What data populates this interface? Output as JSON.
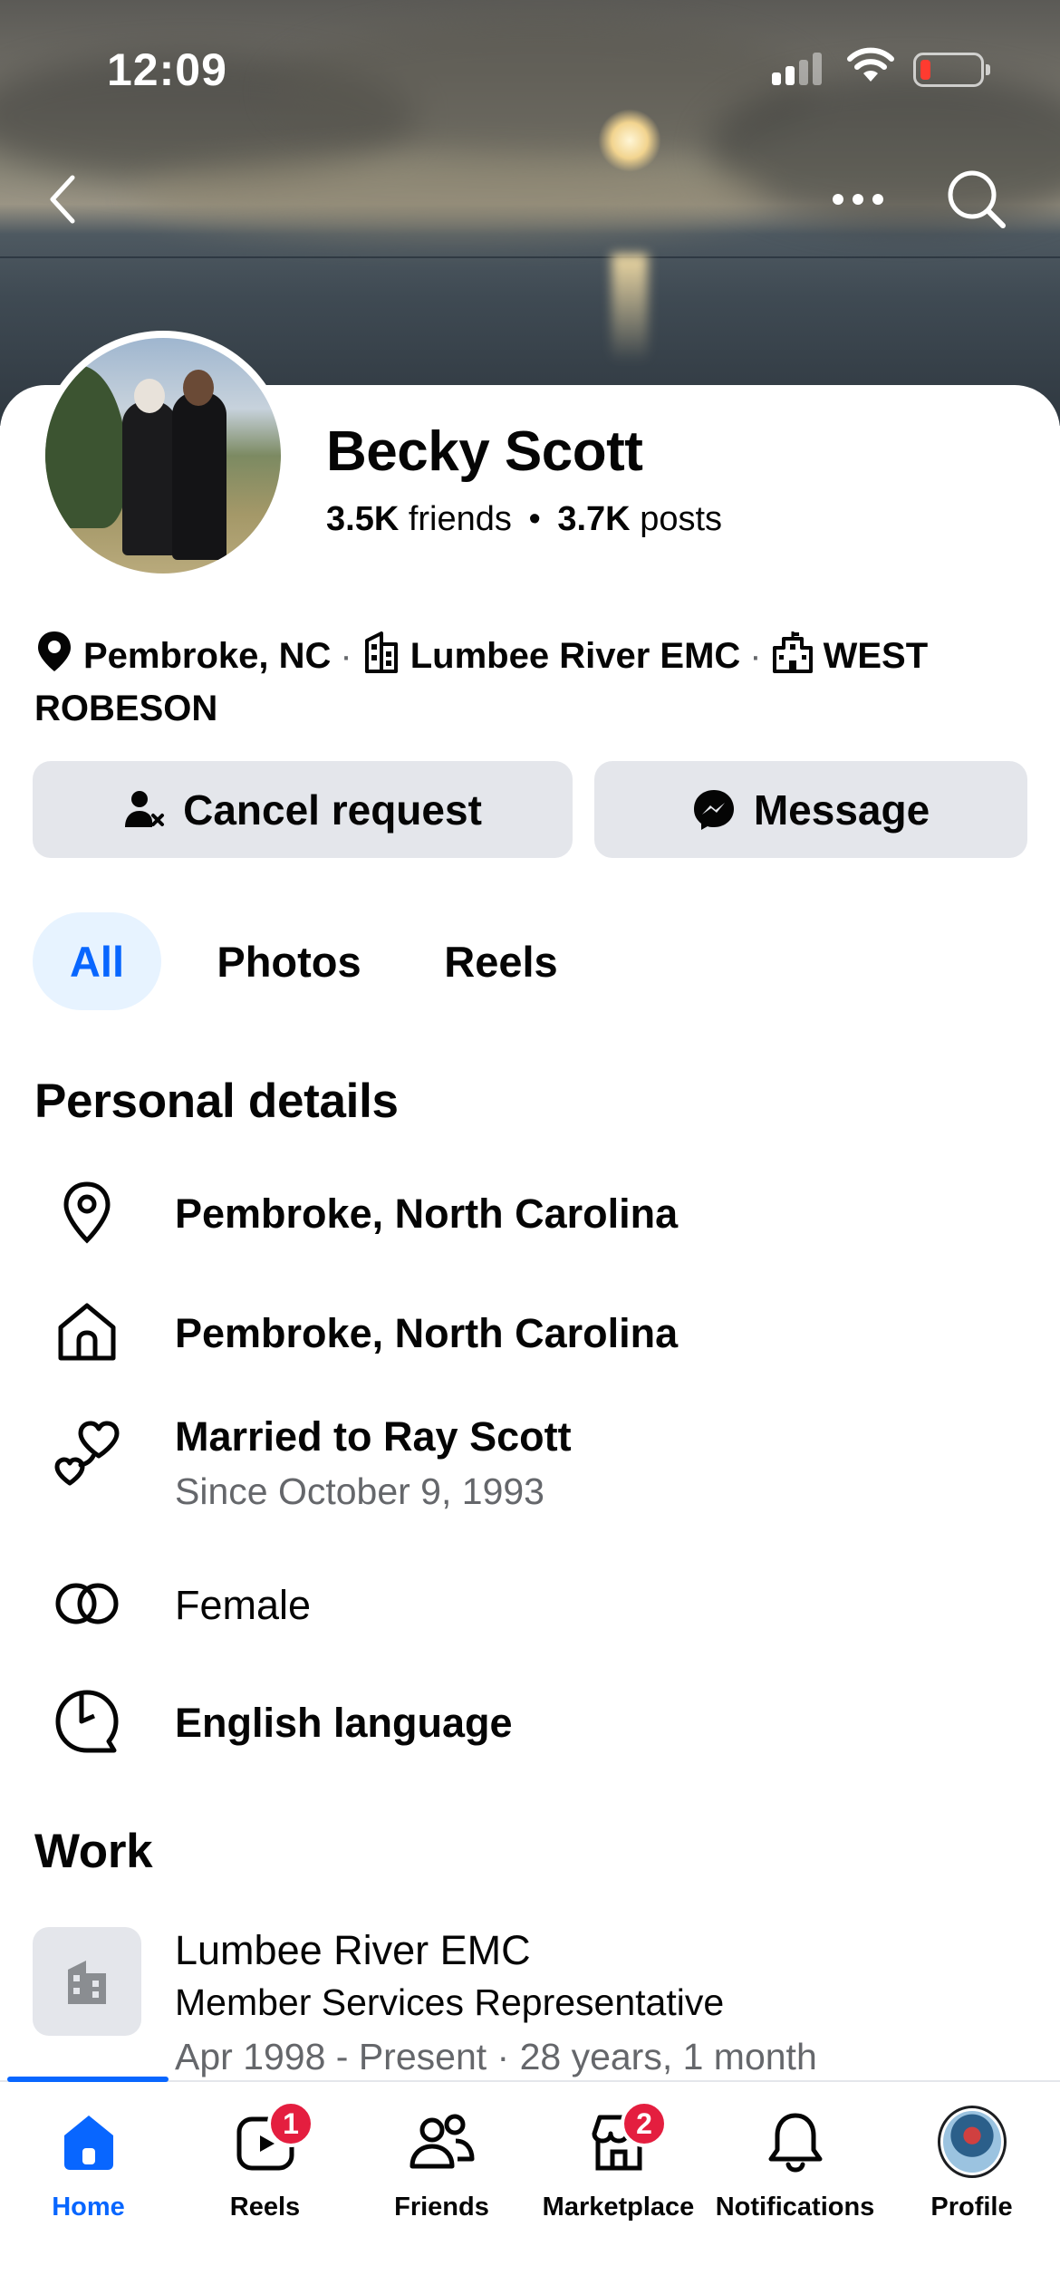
{
  "status_bar": {
    "time": "12:09"
  },
  "profile": {
    "name": "Becky Scott",
    "friends_count": "3.5K",
    "friends_label": "friends",
    "posts_count": "3.7K",
    "posts_label": "posts"
  },
  "intro": {
    "location": "Pembroke, NC",
    "workplace": "Lumbee River EMC",
    "school": "WEST ROBESON"
  },
  "actions": {
    "cancel_request_label": "Cancel request",
    "message_label": "Message"
  },
  "tabs": [
    {
      "label": "All",
      "active": true
    },
    {
      "label": "Photos",
      "active": false
    },
    {
      "label": "Reels",
      "active": false
    }
  ],
  "personal_details": {
    "title": "Personal details",
    "current_city": "Pembroke, North Carolina",
    "hometown": "Pembroke, North Carolina",
    "relationship": "Married to Ray Scott",
    "relationship_since": "Since October 9, 1993",
    "gender": "Female",
    "language": "English language"
  },
  "work": {
    "title": "Work",
    "employer": "Lumbee River EMC",
    "position": "Member Services Representative",
    "duration": "Apr 1998 - Present · 28 years, 1 month"
  },
  "bottom_nav": {
    "home": "Home",
    "reels": "Reels",
    "reels_badge": "1",
    "friends": "Friends",
    "marketplace": "Marketplace",
    "marketplace_badge": "2",
    "notifications": "Notifications",
    "profile": "Profile"
  },
  "colors": {
    "accent": "#0866ff",
    "badge": "#e41e3f",
    "button_bg": "#e4e6eb",
    "secondary_text": "#65676b"
  }
}
